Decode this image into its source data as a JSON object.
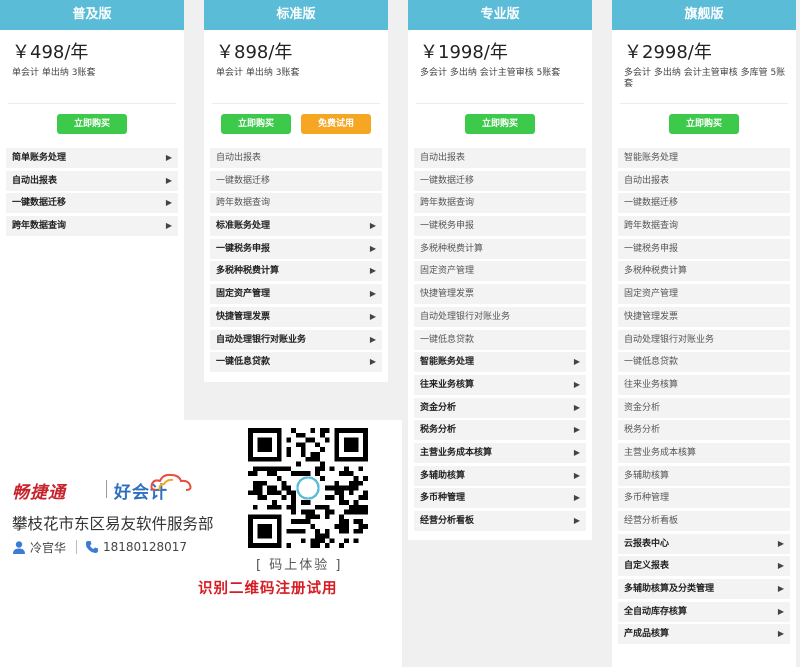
{
  "plans": [
    {
      "name": "普及版",
      "price": "￥498/年",
      "desc": "单会计 单出纳 3账套",
      "buttons": [
        {
          "label": "立即购买",
          "color": "#3dc94a"
        }
      ],
      "features": [
        {
          "label": "简单账务处理",
          "bold": true,
          "arrow": true
        },
        {
          "label": "自动出报表",
          "bold": true,
          "arrow": true
        },
        {
          "label": "一键数据迁移",
          "bold": true,
          "arrow": true
        },
        {
          "label": "跨年数据查询",
          "bold": true,
          "arrow": true
        }
      ]
    },
    {
      "name": "标准版",
      "price": "￥898/年",
      "desc": "单会计 单出纳 3账套",
      "buttons": [
        {
          "label": "立即购买",
          "color": "#3dc94a"
        },
        {
          "label": "免费试用",
          "color": "#f5a623"
        }
      ],
      "features": [
        {
          "label": "自动出报表",
          "bold": false,
          "arrow": false
        },
        {
          "label": "一键数据迁移",
          "bold": false,
          "arrow": false
        },
        {
          "label": "跨年数据查询",
          "bold": false,
          "arrow": false
        },
        {
          "label": "标准账务处理",
          "bold": true,
          "arrow": true
        },
        {
          "label": "一键税务申报",
          "bold": true,
          "arrow": true
        },
        {
          "label": "多税种税费计算",
          "bold": true,
          "arrow": true
        },
        {
          "label": "固定资产管理",
          "bold": true,
          "arrow": true
        },
        {
          "label": "快捷管理发票",
          "bold": true,
          "arrow": true
        },
        {
          "label": "自动处理银行对账业务",
          "bold": true,
          "arrow": true
        },
        {
          "label": "一键低息贷款",
          "bold": true,
          "arrow": true
        }
      ]
    },
    {
      "name": "专业版",
      "price": "￥1998/年",
      "desc": "多会计 多出纳 会计主管审核 5账套",
      "buttons": [
        {
          "label": "立即购买",
          "color": "#3dc94a"
        }
      ],
      "features": [
        {
          "label": "自动出报表",
          "bold": false,
          "arrow": false
        },
        {
          "label": "一键数据迁移",
          "bold": false,
          "arrow": false
        },
        {
          "label": "跨年数据查询",
          "bold": false,
          "arrow": false
        },
        {
          "label": "一键税务申报",
          "bold": false,
          "arrow": false
        },
        {
          "label": "多税种税费计算",
          "bold": false,
          "arrow": false
        },
        {
          "label": "固定资产管理",
          "bold": false,
          "arrow": false
        },
        {
          "label": "快捷管理发票",
          "bold": false,
          "arrow": false
        },
        {
          "label": "自动处理银行对账业务",
          "bold": false,
          "arrow": false
        },
        {
          "label": "一键低息贷款",
          "bold": false,
          "arrow": false
        },
        {
          "label": "智能账务处理",
          "bold": true,
          "arrow": true
        },
        {
          "label": "往来业务核算",
          "bold": true,
          "arrow": true
        },
        {
          "label": "资金分析",
          "bold": true,
          "arrow": true
        },
        {
          "label": "税务分析",
          "bold": true,
          "arrow": true
        },
        {
          "label": "主营业务成本核算",
          "bold": true,
          "arrow": true
        },
        {
          "label": "多辅助核算",
          "bold": true,
          "arrow": true
        },
        {
          "label": "多币种管理",
          "bold": true,
          "arrow": true
        },
        {
          "label": "经营分析看板",
          "bold": true,
          "arrow": true
        }
      ]
    },
    {
      "name": "旗舰版",
      "price": "￥2998/年",
      "desc": "多会计 多出纳 会计主管审核 多库管 5账套",
      "buttons": [
        {
          "label": "立即购买",
          "color": "#3dc94a"
        }
      ],
      "features": [
        {
          "label": "智能账务处理",
          "bold": false,
          "arrow": false
        },
        {
          "label": "自动出报表",
          "bold": false,
          "arrow": false
        },
        {
          "label": "一键数据迁移",
          "bold": false,
          "arrow": false
        },
        {
          "label": "跨年数据查询",
          "bold": false,
          "arrow": false
        },
        {
          "label": "一键税务申报",
          "bold": false,
          "arrow": false
        },
        {
          "label": "多税种税费计算",
          "bold": false,
          "arrow": false
        },
        {
          "label": "固定资产管理",
          "bold": false,
          "arrow": false
        },
        {
          "label": "快捷管理发票",
          "bold": false,
          "arrow": false
        },
        {
          "label": "自动处理银行对账业务",
          "bold": false,
          "arrow": false
        },
        {
          "label": "一键低息贷款",
          "bold": false,
          "arrow": false
        },
        {
          "label": "往来业务核算",
          "bold": false,
          "arrow": false
        },
        {
          "label": "资金分析",
          "bold": false,
          "arrow": false
        },
        {
          "label": "税务分析",
          "bold": false,
          "arrow": false
        },
        {
          "label": "主营业务成本核算",
          "bold": false,
          "arrow": false
        },
        {
          "label": "多辅助核算",
          "bold": false,
          "arrow": false
        },
        {
          "label": "多币种管理",
          "bold": false,
          "arrow": false
        },
        {
          "label": "经营分析看板",
          "bold": false,
          "arrow": false
        },
        {
          "label": "云报表中心",
          "bold": true,
          "arrow": true
        },
        {
          "label": "自定义报表",
          "bold": true,
          "arrow": true
        },
        {
          "label": "多辅助核算及分类管理",
          "bold": true,
          "arrow": true
        },
        {
          "label": "全自动库存核算",
          "bold": true,
          "arrow": true
        },
        {
          "label": "产成品核算",
          "bold": true,
          "arrow": true
        }
      ]
    }
  ],
  "ad": {
    "logo_left": "畅捷通",
    "logo_right": "好会计",
    "company": "攀枝花市东区易友软件服务部",
    "person": "冷官华",
    "phone": "18180128017",
    "qr_caption": "[ 码上体验 ]",
    "qr_bottom": "识别二维码注册试用",
    "user_icon": "user-icon",
    "phone_icon": "phone-icon"
  },
  "colors": {
    "header": "#5bbcd8",
    "buy": "#3dc94a",
    "trial": "#f5a623",
    "brand_red": "#c8232c",
    "brand_blue": "#2f6fc0"
  }
}
